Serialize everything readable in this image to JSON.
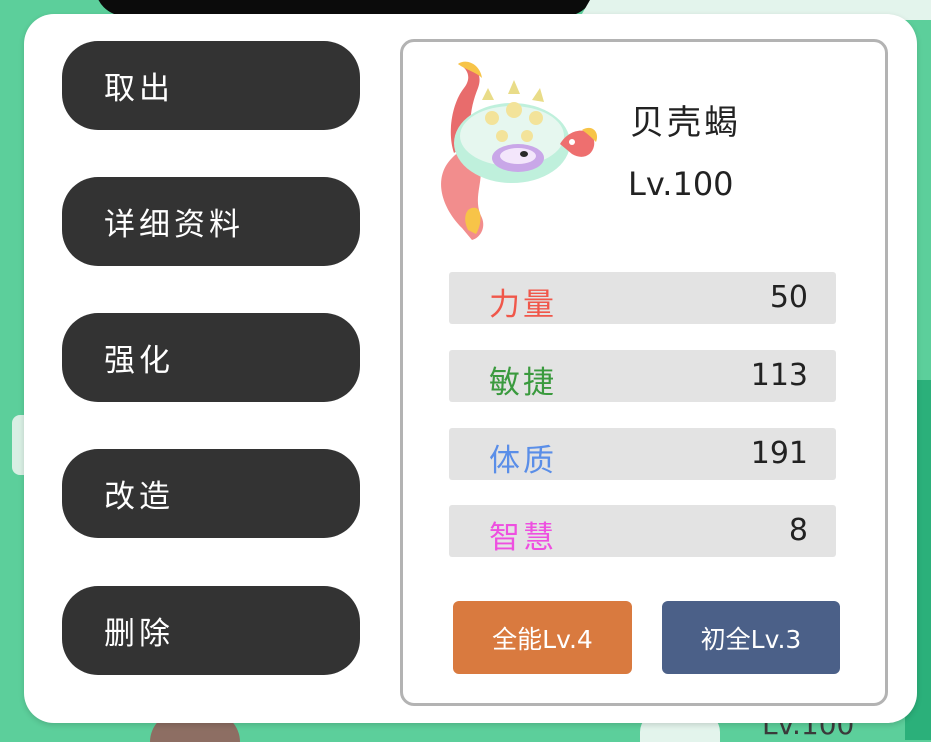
{
  "actions": {
    "withdraw": "取出",
    "details": "详细资料",
    "enhance": "强化",
    "modify": "改造",
    "delete": "删除"
  },
  "pet": {
    "name": "贝壳蝎",
    "level": "Lv.100"
  },
  "stats": [
    {
      "label": "力量",
      "value": "50",
      "color": "#f0574a"
    },
    {
      "label": "敏捷",
      "value": "113",
      "color": "#3a9a3e"
    },
    {
      "label": "体质",
      "value": "191",
      "color": "#5a8ee8"
    },
    {
      "label": "智慧",
      "value": "8",
      "color": "#ee4fe0"
    }
  ],
  "badges": {
    "all_round": {
      "label": "全能Lv.4",
      "color": "#d97a3f"
    },
    "initial": {
      "label": "初全Lv.3",
      "color": "#4b6088"
    }
  },
  "background": {
    "partial_text": "Lv.100"
  },
  "colors": {
    "button_bg": "#333333",
    "page_bg": "#5ccf9b",
    "panel_border": "#b3b3b3"
  }
}
